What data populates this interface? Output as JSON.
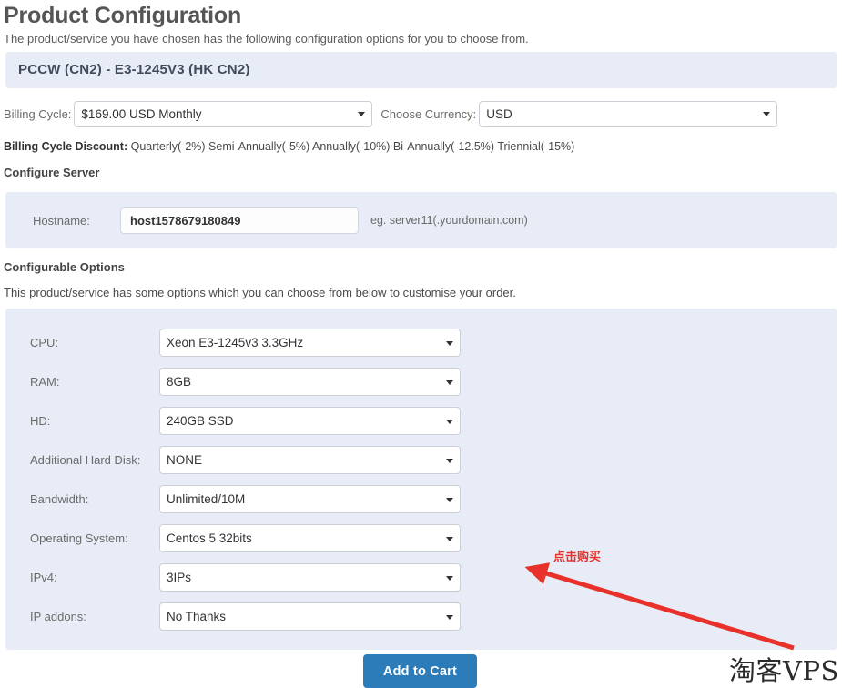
{
  "page": {
    "title": "Product Configuration",
    "subtitle": "The product/service you have chosen has the following configuration options for you to choose from."
  },
  "product_banner": {
    "title": "PCCW  (CN2)   - E3-1245V3  (HK CN2)"
  },
  "billing": {
    "cycle_label": "Billing Cycle:",
    "cycle_value": "$169.00 USD Monthly",
    "currency_label": "Choose Currency:",
    "currency_value": "USD",
    "discount_label": "Billing Cycle Discount:",
    "discount_text": "Quarterly(-2%) Semi-Annually(-5%) Annually(-10%) Bi-Annually(-12.5%) Triennial(-15%)"
  },
  "configure_server": {
    "heading": "Configure Server",
    "hostname_label": "Hostname:",
    "hostname_value": "host1578679180849",
    "hostname_placeholder": "",
    "hostname_hint": "eg. server11(.yourdomain.com)"
  },
  "configurable_options": {
    "heading": "Configurable Options",
    "note": "This product/service has some options which you can choose from below to customise your order.",
    "rows": [
      {
        "label": "CPU:",
        "value": "Xeon E3-1245v3 3.3GHz"
      },
      {
        "label": "RAM:",
        "value": "8GB"
      },
      {
        "label": "HD:",
        "value": "240GB SSD"
      },
      {
        "label": "Additional Hard Disk:",
        "value": "NONE"
      },
      {
        "label": "Bandwidth:",
        "value": "Unlimited/10M"
      },
      {
        "label": "Operating System:",
        "value": "Centos 5 32bits"
      },
      {
        "label": "IPv4:",
        "value": "3IPs"
      },
      {
        "label": "IP addons:",
        "value": "No Thanks"
      }
    ]
  },
  "actions": {
    "add_to_cart_label": "Add to Cart"
  },
  "annotation": {
    "text": "点击购买",
    "color": "#e8312a"
  },
  "watermark": {
    "text": "淘客VPS"
  },
  "colors": {
    "panel_background": "#e7ecf6",
    "button_primary": "#2b7cb9",
    "annotation_red": "#e8312a"
  }
}
